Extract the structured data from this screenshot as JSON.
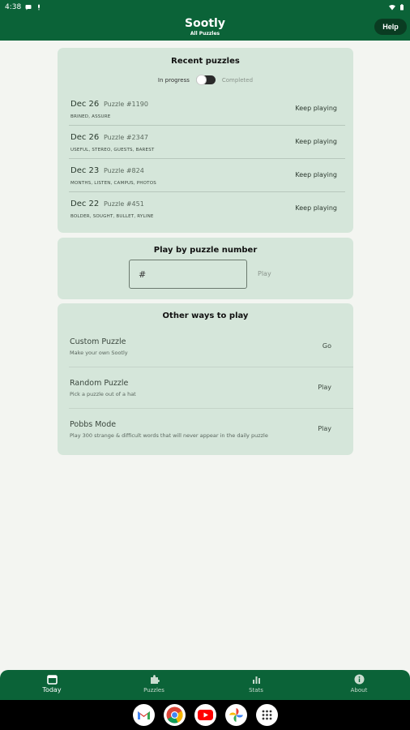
{
  "status_bar": {
    "time": "4:38"
  },
  "app_bar": {
    "title": "Sootly",
    "subtitle": "All Puzzles",
    "help_label": "Help"
  },
  "recent": {
    "title": "Recent puzzles",
    "toggle_left": "In progress",
    "toggle_right": "Completed",
    "toggle_on": false,
    "items": [
      {
        "date": "Dec 26",
        "number": "Puzzle #1190",
        "words": "BRINED, ASSURE",
        "action": "Keep playing"
      },
      {
        "date": "Dec 26",
        "number": "Puzzle #2347",
        "words": "USEFUL, STEREO, GUESTS, BAREST",
        "action": "Keep playing"
      },
      {
        "date": "Dec 23",
        "number": "Puzzle #824",
        "words": "MONTHS, LISTEN, CAMPUS, PHOTOS",
        "action": "Keep playing"
      },
      {
        "date": "Dec 22",
        "number": "Puzzle #451",
        "words": "BOLDER, SOUGHT, BULLET, RYLINE",
        "action": "Keep playing"
      }
    ]
  },
  "play_by_number": {
    "title": "Play by puzzle number",
    "input_placeholder": "#",
    "play_label": "Play"
  },
  "other_ways": {
    "title": "Other ways to play",
    "items": [
      {
        "name": "Custom Puzzle",
        "description": "Make your own Sootly",
        "action": "Go"
      },
      {
        "name": "Random Puzzle",
        "description": "Pick a puzzle out of a hat",
        "action": "Play"
      },
      {
        "name": "Pobbs Mode",
        "description": "Play 300 strange & difficult words that will never appear in the daily puzzle",
        "action": "Play"
      }
    ]
  },
  "bottom_nav": [
    {
      "label": "Today",
      "icon": "calendar-icon",
      "active": true
    },
    {
      "label": "Puzzles",
      "icon": "puzzle-piece-icon",
      "active": false
    },
    {
      "label": "Stats",
      "icon": "bar-chart-icon",
      "active": false
    },
    {
      "label": "About",
      "icon": "info-icon",
      "active": false
    }
  ],
  "dock": [
    "gmail-icon",
    "chrome-icon",
    "youtube-icon",
    "photos-icon",
    "app-drawer-icon"
  ],
  "colors": {
    "brand": "#0b6338",
    "card": "#d5e6da",
    "background": "#f3f5f1"
  }
}
